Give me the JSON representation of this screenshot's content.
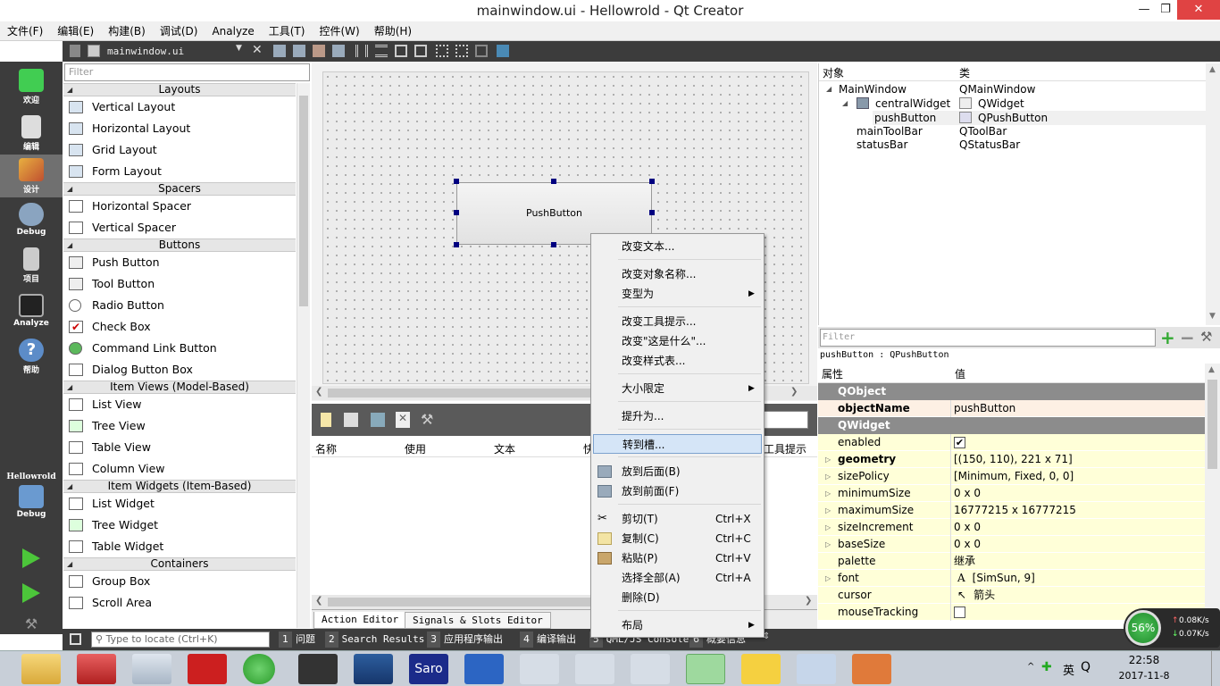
{
  "window": {
    "title": "mainwindow.ui - Hellowrold - Qt Creator"
  },
  "menubar": [
    "文件(F)",
    "编辑(E)",
    "构建(B)",
    "调试(D)",
    "Analyze",
    "工具(T)",
    "控件(W)",
    "帮助(H)"
  ],
  "modes": [
    {
      "label": "欢迎",
      "icon": "qt-welcome-icon"
    },
    {
      "label": "编辑",
      "icon": "edit-doc-icon"
    },
    {
      "label": "设计",
      "icon": "design-brush-icon"
    },
    {
      "label": "Debug",
      "icon": "debug-bug-icon"
    },
    {
      "label": "项目",
      "icon": "project-icon"
    },
    {
      "label": "Analyze",
      "icon": "analyze-icon"
    },
    {
      "label": "帮助",
      "icon": "help-icon"
    }
  ],
  "kit": {
    "project": "Hellowrold",
    "config": "Debug"
  },
  "doc": {
    "filename": "mainwindow.ui"
  },
  "widgetbox": {
    "filter_placeholder": "Filter",
    "categories": {
      "layouts": "Layouts",
      "spacers": "Spacers",
      "buttons": "Buttons",
      "item_views": "Item Views (Model-Based)",
      "item_widgets": "Item Widgets (Item-Based)",
      "containers": "Containers"
    },
    "items": {
      "vertical_layout": "Vertical Layout",
      "horizontal_layout": "Horizontal Layout",
      "grid_layout": "Grid Layout",
      "form_layout": "Form Layout",
      "horizontal_spacer": "Horizontal Spacer",
      "vertical_spacer": "Vertical Spacer",
      "push_button": "Push Button",
      "tool_button": "Tool Button",
      "radio_button": "Radio Button",
      "check_box": "Check Box",
      "command_link": "Command Link Button",
      "dialog_button_box": "Dialog Button Box",
      "list_view": "List View",
      "tree_view": "Tree View",
      "table_view": "Table View",
      "column_view": "Column View",
      "list_widget": "List Widget",
      "tree_widget": "Tree Widget",
      "table_widget": "Table Widget",
      "group_box": "Group Box",
      "scroll_area": "Scroll Area"
    }
  },
  "form": {
    "pushbutton_text": "PushButton"
  },
  "action_editor": {
    "columns": [
      "名称",
      "使用",
      "文本",
      "快",
      "工具提示"
    ],
    "tabs": [
      "Action Editor",
      "Signals & Slots Editor"
    ]
  },
  "context_menu": {
    "change_text": "改变文本...",
    "change_object_name": "改变对象名称...",
    "morph_into": "变型为",
    "change_tooltip": "改变工具提示...",
    "change_whats_this": "改变\"这是什么\"...",
    "change_stylesheet": "改变样式表...",
    "size_constraints": "大小限定",
    "promote_to": "提升为...",
    "go_to_slot": "转到槽...",
    "send_to_back": "放到后面(B)",
    "bring_to_front": "放到前面(F)",
    "cut": "剪切(T)",
    "cut_sc": "Ctrl+X",
    "copy": "复制(C)",
    "copy_sc": "Ctrl+C",
    "paste": "粘贴(P)",
    "paste_sc": "Ctrl+V",
    "select_all": "选择全部(A)",
    "select_all_sc": "Ctrl+A",
    "delete": "删除(D)",
    "layout": "布局"
  },
  "object_inspector": {
    "col_object": "对象",
    "col_class": "类",
    "rows": [
      {
        "name": "MainWindow",
        "class": "QMainWindow"
      },
      {
        "name": "centralWidget",
        "class": "QWidget"
      },
      {
        "name": "pushButton",
        "class": "QPushButton"
      },
      {
        "name": "mainToolBar",
        "class": "QToolBar"
      },
      {
        "name": "statusBar",
        "class": "QStatusBar"
      }
    ]
  },
  "property_editor": {
    "filter_placeholder": "Filter",
    "current": "pushButton : QPushButton",
    "col_prop": "属性",
    "col_value": "值",
    "cat_qobject": "QObject",
    "cat_qwidget": "QWidget",
    "objectName": {
      "name": "objectName",
      "value": "pushButton"
    },
    "enabled": {
      "name": "enabled",
      "checked": true
    },
    "geometry": {
      "name": "geometry",
      "value": "[(150, 110), 221 x 71]"
    },
    "sizePolicy": {
      "name": "sizePolicy",
      "value": "[Minimum, Fixed, 0, 0]"
    },
    "minimumSize": {
      "name": "minimumSize",
      "value": "0 x 0"
    },
    "maximumSize": {
      "name": "maximumSize",
      "value": "16777215 x 16777215"
    },
    "sizeIncrement": {
      "name": "sizeIncrement",
      "value": "0 x 0"
    },
    "baseSize": {
      "name": "baseSize",
      "value": "0 x 0"
    },
    "palette": {
      "name": "palette",
      "value": "继承"
    },
    "font": {
      "name": "font",
      "value": "[SimSun, 9]"
    },
    "cursor": {
      "name": "cursor",
      "value": "箭头"
    },
    "mouseTracking": {
      "name": "mouseTracking",
      "checked": false
    }
  },
  "statusbar": {
    "locator_placeholder": "Type to locate (Ctrl+K)",
    "panes": [
      {
        "num": "1",
        "label": "问题"
      },
      {
        "num": "2",
        "label": "Search Results"
      },
      {
        "num": "3",
        "label": "应用程序输出"
      },
      {
        "num": "4",
        "label": "编译输出"
      },
      {
        "num": "5",
        "label": "QML/JS Console"
      },
      {
        "num": "6",
        "label": "概要信息"
      }
    ]
  },
  "net": {
    "percent": "56%",
    "up": "0.08K/s",
    "down": "0.07K/s"
  },
  "taskbar": {
    "time": "22:58",
    "date": "2017-11-8",
    "ime": "英"
  }
}
